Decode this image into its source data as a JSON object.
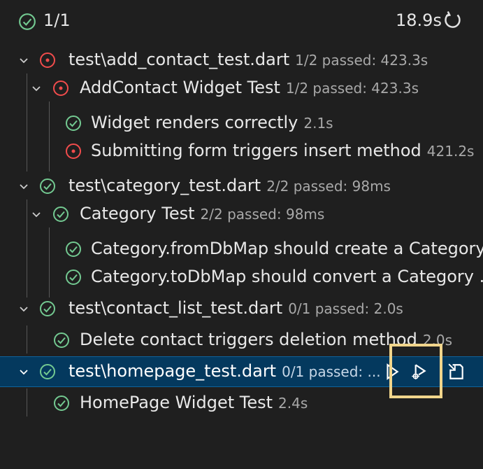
{
  "header": {
    "count": "1/1",
    "duration": "18.9s"
  },
  "tree": {
    "file1": {
      "name": "test\\add_contact_test.dart",
      "meta": "1/2 passed: 423.3s"
    },
    "group1": {
      "name": "AddContact Widget Test",
      "meta": "1/2 passed: 423.3s"
    },
    "test1": {
      "name": "Widget renders correctly",
      "meta": "2.1s"
    },
    "test2": {
      "name": "Submitting form triggers insert method",
      "meta": "421.2s"
    },
    "file2": {
      "name": "test\\category_test.dart",
      "meta": "2/2 passed: 98ms"
    },
    "group2": {
      "name": "Category Test",
      "meta": "2/2 passed: 98ms"
    },
    "test3": {
      "name": "Category.fromDbMap should create a Category..."
    },
    "test4": {
      "name": "Category.toDbMap should convert a Category ..."
    },
    "file3": {
      "name": "test\\contact_list_test.dart",
      "meta": "0/1 passed: 2.0s"
    },
    "test5": {
      "name": "Delete contact triggers deletion method",
      "meta": "2.0s"
    },
    "file4": {
      "name": "test\\homepage_test.dart",
      "meta": "0/1 passed: ..."
    },
    "test6": {
      "name": "HomePage Widget Test",
      "meta": "2.4s"
    }
  },
  "colors": {
    "pass": "#73c991",
    "fail": "#f14c4c",
    "selected_bg": "#04395e",
    "highlight": "#f1d58b"
  },
  "icons": [
    "check-circle-icon",
    "error-circle-icon",
    "chevron-down-icon",
    "refresh-icon",
    "run-icon",
    "debug-icon",
    "go-to-file-icon"
  ]
}
